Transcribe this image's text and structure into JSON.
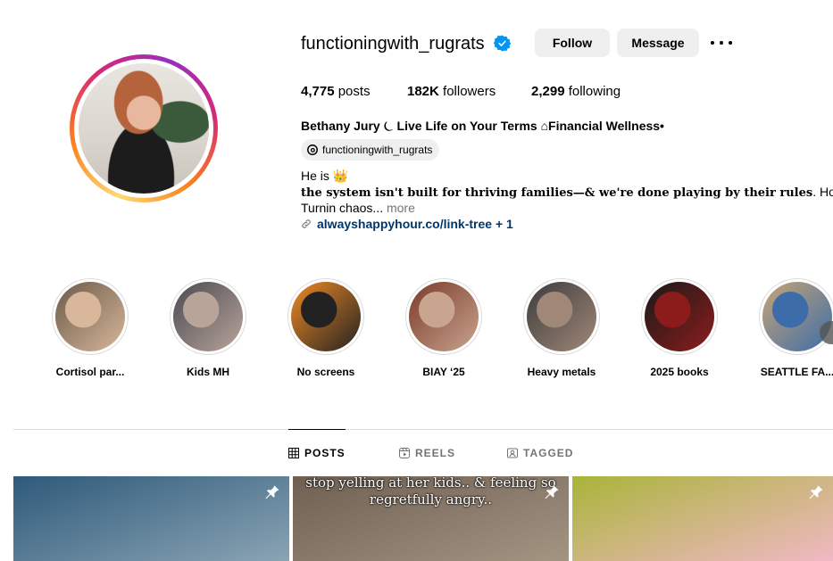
{
  "profile": {
    "username": "functioningwith_rugrats",
    "follow_label": "Follow",
    "message_label": "Message",
    "stats": {
      "posts_count": "4,775",
      "posts_label": " posts",
      "followers_count": "182K",
      "followers_label": " followers",
      "following_count": "2,299",
      "following_label": " following"
    },
    "full_name": "Bethany Jury ⏾ Live Life on Your Terms ⌂Financial Wellness•",
    "threads_handle": "functioningwith_rugrats",
    "bio": {
      "line1": "He is 👑",
      "line2_bold": "the system isn't built for thriving families—& we're done playing by their rules",
      "line2_rest": ". HolisticKids",
      "line3": "Turnin chaos...",
      "more": " more"
    },
    "link": "alwayshappyhour.co/link-tree + 1"
  },
  "highlights": [
    {
      "label": "Cortisol par...",
      "colors": [
        "#6b5a4a",
        "#d8b79a"
      ]
    },
    {
      "label": "Kids MH",
      "colors": [
        "#4a4a52",
        "#b9a49a"
      ]
    },
    {
      "label": "No screens",
      "colors": [
        "#f08a24",
        "#222"
      ]
    },
    {
      "label": "BIAY ‘25",
      "colors": [
        "#7a3a2c",
        "#c9a48e"
      ]
    },
    {
      "label": "Heavy metals",
      "colors": [
        "#3c3c3c",
        "#a08878"
      ]
    },
    {
      "label": "2025 books",
      "colors": [
        "#1a1a1a",
        "#8c1c1c"
      ]
    },
    {
      "label": "SEATTLE FA...",
      "colors": [
        "#c7a477",
        "#3d6da8"
      ]
    }
  ],
  "tabs": [
    {
      "label": "POSTS",
      "icon": "grid-icon",
      "active": true
    },
    {
      "label": "REELS",
      "icon": "reels-icon",
      "active": false
    },
    {
      "label": "TAGGED",
      "icon": "tagged-icon",
      "active": false
    }
  ],
  "posts": [
    {
      "caption": "",
      "colors": [
        "#2e5a7a",
        "#8aa4b4"
      ]
    },
    {
      "caption": "stop yelling at her kids.. & feeling so regretfully angry..",
      "colors": [
        "#6e5f52",
        "#a49482"
      ]
    },
    {
      "caption": "",
      "colors": [
        "#a9b43a",
        "#f0b8c4"
      ]
    }
  ],
  "colors": {
    "link": "#00376b",
    "verified": "#0095f6",
    "button_bg": "#efefef",
    "muted": "#737373"
  }
}
